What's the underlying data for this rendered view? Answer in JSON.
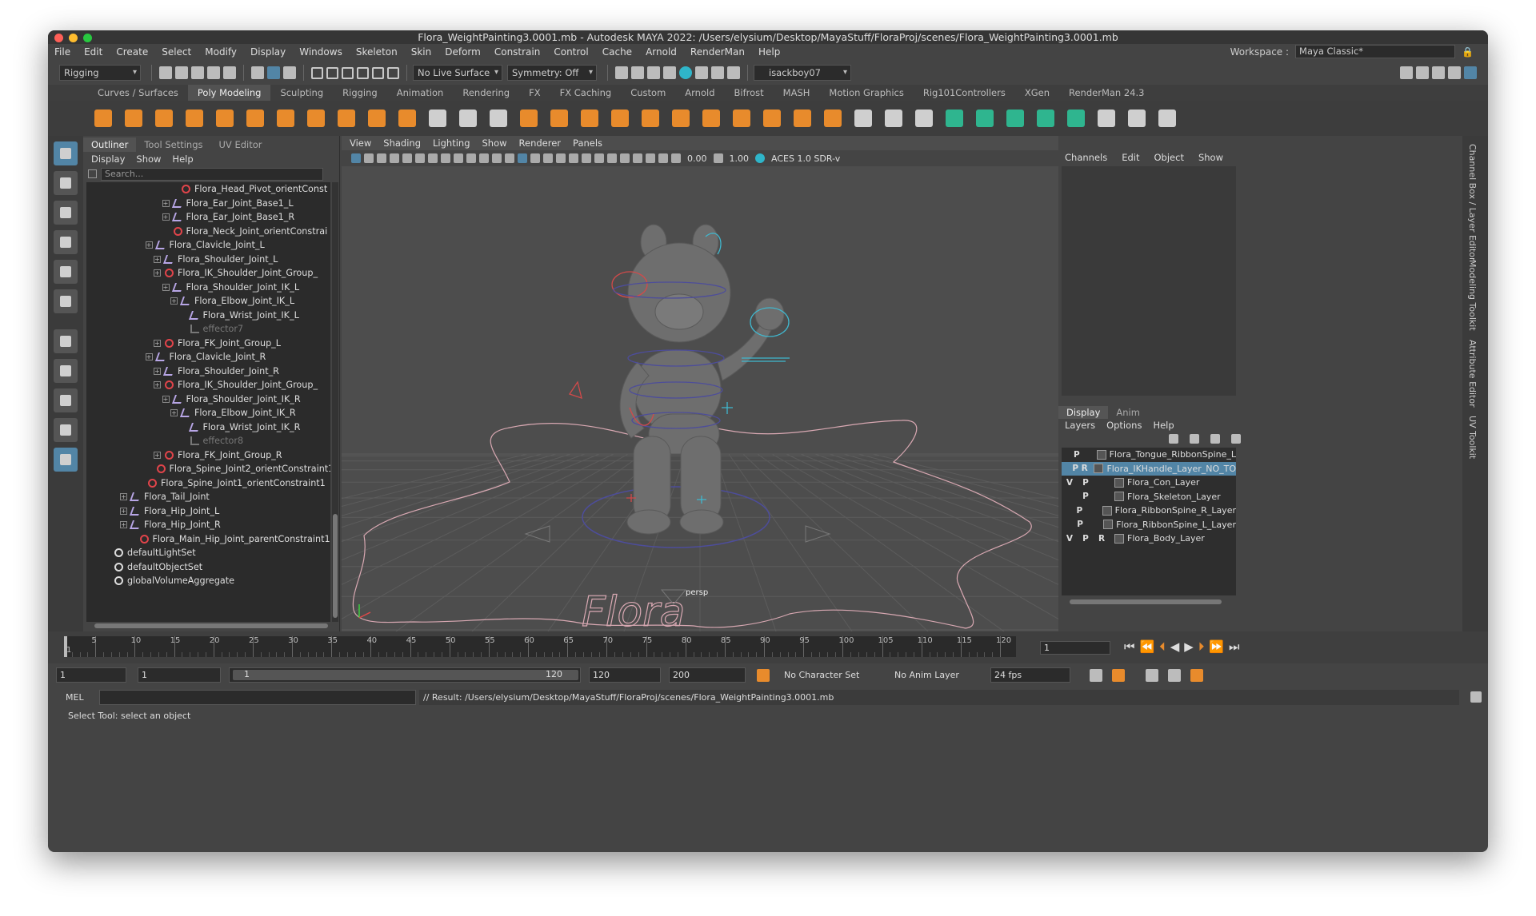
{
  "title": "Flora_WeightPainting3.0001.mb - Autodesk MAYA 2022: /Users/elysium/Desktop/MayaStuff/FloraProj/scenes/Flora_WeightPainting3.0001.mb",
  "menus": [
    "File",
    "Edit",
    "Create",
    "Select",
    "Modify",
    "Display",
    "Windows",
    "Skeleton",
    "Skin",
    "Deform",
    "Constrain",
    "Control",
    "Cache",
    "Arnold",
    "RenderMan",
    "Help"
  ],
  "workspace": {
    "label": "Workspace :",
    "value": "Maya Classic*"
  },
  "status": {
    "menuset": "Rigging",
    "live_surface": "No Live Surface",
    "symmetry": "Symmetry: Off",
    "user": "isackboy07"
  },
  "shelf_tabs": [
    "Curves / Surfaces",
    "Poly Modeling",
    "Sculpting",
    "Rigging",
    "Animation",
    "Rendering",
    "FX",
    "FX Caching",
    "Custom",
    "Arnold",
    "Bifrost",
    "MASH",
    "Motion Graphics",
    "Rig101Controllers",
    "XGen",
    "RenderMan 24.3"
  ],
  "outliner": {
    "tabs": [
      "Outliner",
      "Tool Settings",
      "UV Editor"
    ],
    "menus": [
      "Display",
      "Show",
      "Help"
    ],
    "search_placeholder": "Search...",
    "items": [
      {
        "label": "Flora_Head_Pivot_orientConst",
        "type": "constraint",
        "indent": 10
      },
      {
        "label": "Flora_Ear_Joint_Base1_L",
        "type": "joint",
        "indent": 9,
        "exp": true
      },
      {
        "label": "Flora_Ear_Joint_Base1_R",
        "type": "joint",
        "indent": 9,
        "exp": true
      },
      {
        "label": "Flora_Neck_Joint_orientConstrai",
        "type": "constraint",
        "indent": 9
      },
      {
        "label": "Flora_Clavicle_Joint_L",
        "type": "joint",
        "indent": 7,
        "exp": true
      },
      {
        "label": "Flora_Shoulder_Joint_L",
        "type": "joint",
        "indent": 8,
        "exp": true
      },
      {
        "label": "Flora_IK_Shoulder_Joint_Group_",
        "type": "constraint",
        "indent": 8,
        "exp": true
      },
      {
        "label": "Flora_Shoulder_Joint_IK_L",
        "type": "joint",
        "indent": 9,
        "exp": true
      },
      {
        "label": "Flora_Elbow_Joint_IK_L",
        "type": "joint",
        "indent": 10,
        "exp": true
      },
      {
        "label": "Flora_Wrist_Joint_IK_L",
        "type": "joint",
        "indent": 11
      },
      {
        "label": "effector7",
        "type": "effector",
        "indent": 11
      },
      {
        "label": "Flora_FK_Joint_Group_L",
        "type": "constraint",
        "indent": 8,
        "exp": true
      },
      {
        "label": "Flora_Clavicle_Joint_R",
        "type": "joint",
        "indent": 7,
        "exp": true
      },
      {
        "label": "Flora_Shoulder_Joint_R",
        "type": "joint",
        "indent": 8,
        "exp": true
      },
      {
        "label": "Flora_IK_Shoulder_Joint_Group_",
        "type": "constraint",
        "indent": 8,
        "exp": true
      },
      {
        "label": "Flora_Shoulder_Joint_IK_R",
        "type": "joint",
        "indent": 9,
        "exp": true
      },
      {
        "label": "Flora_Elbow_Joint_IK_R",
        "type": "joint",
        "indent": 10,
        "exp": true
      },
      {
        "label": "Flora_Wrist_Joint_IK_R",
        "type": "joint",
        "indent": 11
      },
      {
        "label": "effector8",
        "type": "effector",
        "indent": 11
      },
      {
        "label": "Flora_FK_Joint_Group_R",
        "type": "constraint",
        "indent": 8,
        "exp": true
      },
      {
        "label": "Flora_Spine_Joint2_orientConstraint1",
        "type": "constraint",
        "indent": 7
      },
      {
        "label": "Flora_Spine_Joint1_orientConstraint1",
        "type": "constraint",
        "indent": 6
      },
      {
        "label": "Flora_Tail_Joint",
        "type": "joint",
        "indent": 4,
        "exp": true
      },
      {
        "label": "Flora_Hip_Joint_L",
        "type": "joint",
        "indent": 4,
        "exp": true
      },
      {
        "label": "Flora_Hip_Joint_R",
        "type": "joint",
        "indent": 4,
        "exp": true
      },
      {
        "label": "Flora_Main_Hip_Joint_parentConstraint1",
        "type": "constraint",
        "indent": 5
      },
      {
        "label": "defaultLightSet",
        "type": "set",
        "indent": 2
      },
      {
        "label": "defaultObjectSet",
        "type": "set",
        "indent": 2
      },
      {
        "label": "globalVolumeAggregate",
        "type": "set",
        "indent": 2
      }
    ]
  },
  "viewport": {
    "menus": [
      "View",
      "Shading",
      "Lighting",
      "Show",
      "Renderer",
      "Panels"
    ],
    "exposure": "0.00",
    "gamma": "1.00",
    "colorspace": "ACES 1.0 SDR-v",
    "camera": "persp",
    "ground_text": "Flora"
  },
  "channel_box": {
    "menus": [
      "Channels",
      "Edit",
      "Object",
      "Show"
    ]
  },
  "layer_editor": {
    "tabs": [
      "Display",
      "Anim"
    ],
    "menus": [
      "Layers",
      "Options",
      "Help"
    ],
    "layers": [
      {
        "v": "",
        "p": "P",
        "r": "",
        "name": "Flora_Tongue_RibbonSpine_L",
        "selected": false
      },
      {
        "v": "",
        "p": "P",
        "r": "R",
        "name": "Flora_IKHandle_Layer_NO_TO",
        "selected": true
      },
      {
        "v": "V",
        "p": "P",
        "r": "",
        "name": "Flora_Con_Layer",
        "selected": false
      },
      {
        "v": "",
        "p": "P",
        "r": "",
        "name": "Flora_Skeleton_Layer",
        "selected": false
      },
      {
        "v": "",
        "p": "P",
        "r": "",
        "name": "Flora_RibbonSpine_R_Layer",
        "selected": false
      },
      {
        "v": "",
        "p": "P",
        "r": "",
        "name": "Flora_RibbonSpine_L_Layer",
        "selected": false
      },
      {
        "v": "V",
        "p": "P",
        "r": "R",
        "name": "Flora_Body_Layer",
        "selected": false
      }
    ]
  },
  "side_tabs": [
    "Channel Box / Layer Editor",
    "Modeling Toolkit",
    "Attribute Editor",
    "UV Toolkit"
  ],
  "timeline": {
    "ticks": [
      "1",
      "5",
      "10",
      "15",
      "20",
      "25",
      "30",
      "35",
      "40",
      "45",
      "50",
      "55",
      "60",
      "65",
      "70",
      "75",
      "80",
      "85",
      "90",
      "95",
      "100",
      "105",
      "110",
      "115",
      "120"
    ],
    "current_frame": "1",
    "range_start_label": "1",
    "range_end_label": "120"
  },
  "range": {
    "start": "1",
    "anim_start": "1",
    "playback_end": "120",
    "anim_end": "200",
    "character_set": "No Character Set",
    "anim_layer": "No Anim Layer",
    "fps": "24 fps"
  },
  "command": {
    "lang": "MEL",
    "result": "// Result: /Users/elysium/Desktop/MayaStuff/FloraProj/scenes/Flora_WeightPainting3.0001.mb"
  },
  "help_line": "Select Tool: select an object",
  "colors": {
    "accent_blue": "#5285a6",
    "shelf_orange": "#e88b2c",
    "shelf_teal": "#2fb58f",
    "maya_logo": "#17b3c9"
  }
}
